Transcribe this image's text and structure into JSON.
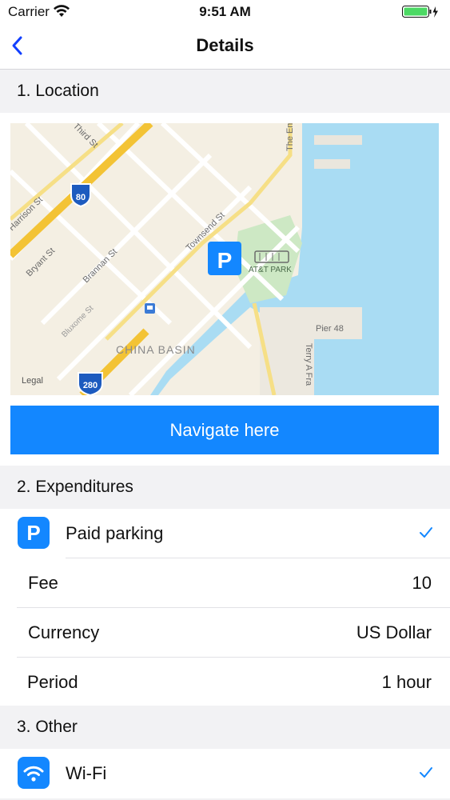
{
  "status_bar": {
    "carrier": "Carrier",
    "time": "9:51 AM"
  },
  "nav": {
    "title": "Details",
    "back_icon": "chevron-left-icon"
  },
  "sections": {
    "location": "1. Location",
    "expenditures": "2. Expenditures",
    "other": "3. Other"
  },
  "map": {
    "labels": {
      "third_st": "Third St",
      "harrison_st": "Harrison St",
      "bryant_st": "Bryant St",
      "brannan_st": "Brannan St",
      "townsend_st": "Townsend St",
      "bluxome_st": "Bluxome St",
      "the_embarcadero": "The Em",
      "terry_a_francois": "Terry A Fra",
      "pier_48": "Pier 48",
      "att_park": "AT&T PARK",
      "china_basin": "CHINA BASIN",
      "legal": "Legal",
      "i80": "80",
      "i280": "280",
      "parking_marker": "P"
    }
  },
  "navigate_button": "Navigate here",
  "expenditures": {
    "paid_parking": {
      "label": "Paid parking",
      "icon": "P",
      "checked": true
    },
    "fee": {
      "label": "Fee",
      "value": "10"
    },
    "currency": {
      "label": "Currency",
      "value": "US Dollar"
    },
    "period": {
      "label": "Period",
      "value": "1 hour"
    }
  },
  "other": {
    "wifi": {
      "label": "Wi-Fi",
      "icon": "wifi-icon",
      "checked": true
    }
  },
  "colors": {
    "accent": "#1387ff",
    "water": "#a9dcf3",
    "park": "#cde8c4"
  }
}
